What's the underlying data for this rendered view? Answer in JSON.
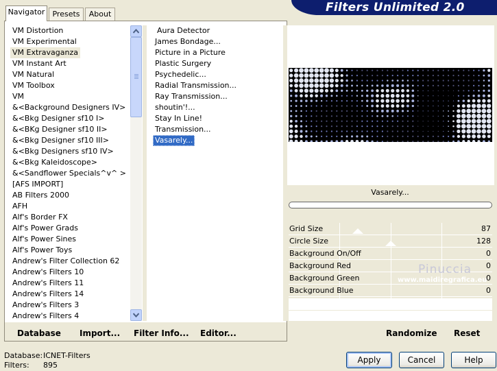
{
  "brand": "Filters Unlimited 2.0",
  "tabs": [
    {
      "label": "Navigator",
      "active": true
    },
    {
      "label": "Presets",
      "active": false
    },
    {
      "label": "About",
      "active": false
    }
  ],
  "categories": [
    "VM Distortion",
    "VM Experimental",
    "VM Extravaganza",
    "VM Instant Art",
    "VM Natural",
    "VM Toolbox",
    "VM",
    "&<Background Designers IV>",
    "&<Bkg Designer sf10 I>",
    "&<BKg Designer sf10 II>",
    "&<Bkg Designer sf10 III>",
    "&<Bkg Designers sf10 IV>",
    "&<Bkg Kaleidoscope>",
    "&<Sandflower Specials^v^ >",
    "[AFS IMPORT]",
    "AB Filters 2000",
    "AFH",
    "Alf's Border FX",
    "Alf's Power Grads",
    "Alf's Power Sines",
    "Alf's Power Toys",
    "Andrew's Filter Collection 62",
    "Andrew's Filters 10",
    "Andrew's Filters 11",
    "Andrew's Filters 14",
    "Andrew's Filters 3",
    "Andrew's Filters 4"
  ],
  "selected_category": "VM Extravaganza",
  "filters": [
    "Aura Detector",
    "James Bondage...",
    "Picture in a Picture",
    "Plastic Surgery",
    "Psychedelic...",
    "Radial Transmission...",
    "Ray Transmission...",
    "shoutin'!...",
    "Stay In Line!",
    "Transmission...",
    "Vasarely..."
  ],
  "selected_filter": "Vasarely...",
  "preview_title": "Vasarely...",
  "progress": 0,
  "params": [
    {
      "label": "Grid Size",
      "value": "87"
    },
    {
      "label": "Circle Size",
      "value": "128"
    },
    {
      "label": "Background On/Off",
      "value": "0"
    },
    {
      "label": "Background Red",
      "value": "0"
    },
    {
      "label": "Background Green",
      "value": "0"
    },
    {
      "label": "Background Blue",
      "value": "0"
    }
  ],
  "slider_levels": {
    "grid_size": 0.34,
    "circle_size": 0.5
  },
  "watermark": {
    "name": "Pinuccia",
    "url": "www.maidiregrafica.eu"
  },
  "bottom_buttons": {
    "database": "Database",
    "import": "Import...",
    "filter_info": "Filter Info...",
    "editor": "Editor...",
    "randomize": "Randomize",
    "reset": "Reset"
  },
  "status": {
    "database_label": "Database:",
    "database_value": "ICNET-Filters",
    "filters_label": "Filters:",
    "filters_value": "895"
  },
  "dialog_buttons": {
    "apply": "Apply",
    "cancel": "Cancel",
    "help": "Help"
  },
  "colors": {
    "brand_bg": "#0d1e6e",
    "selection": "#316ac5",
    "window_bg": "#ece9d8"
  }
}
